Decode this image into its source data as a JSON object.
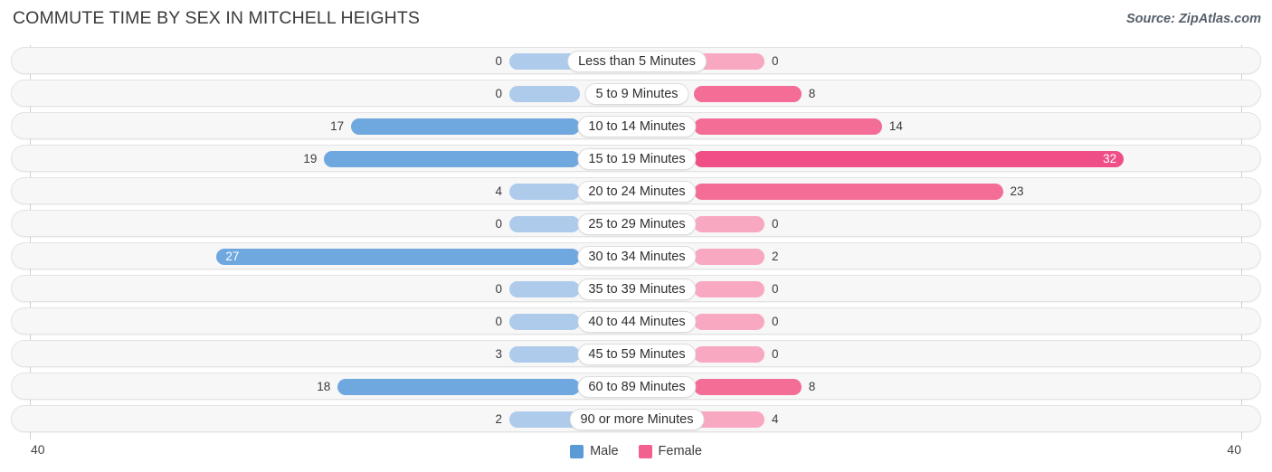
{
  "header": {
    "title": "COMMUTE TIME BY SEX IN MITCHELL HEIGHTS",
    "source": "Source: ZipAtlas.com"
  },
  "axis": {
    "left_tick": "40",
    "right_tick": "40"
  },
  "legend": {
    "items": [
      {
        "label": "Male",
        "color": "#5B9BD5"
      },
      {
        "label": "Female",
        "color": "#F2608F"
      }
    ]
  },
  "colors": {
    "male_strong": "#6EA8DE",
    "male_light": "#AECBEB",
    "female_strong": "#F46D96",
    "female_light": "#F8A8C0",
    "female_bright": "#F04E87",
    "row_bg": "#F7F7F7",
    "row_border": "#E3E3E3"
  },
  "chart_data": {
    "type": "bar",
    "orientation": "horizontal",
    "style": "diverging-tornado",
    "title": "COMMUTE TIME BY SEX IN MITCHELL HEIGHTS",
    "xlabel": "",
    "ylabel": "",
    "xlim": [
      40,
      40
    ],
    "axis_max": 40,
    "grid": false,
    "legend_position": "bottom-center",
    "categories": [
      "Less than 5 Minutes",
      "5 to 9 Minutes",
      "10 to 14 Minutes",
      "15 to 19 Minutes",
      "20 to 24 Minutes",
      "25 to 29 Minutes",
      "30 to 34 Minutes",
      "35 to 39 Minutes",
      "40 to 44 Minutes",
      "45 to 59 Minutes",
      "60 to 89 Minutes",
      "90 or more Minutes"
    ],
    "series": [
      {
        "name": "Male",
        "side": "left",
        "values": [
          0,
          0,
          17,
          19,
          4,
          0,
          27,
          0,
          0,
          3,
          18,
          2
        ]
      },
      {
        "name": "Female",
        "side": "right",
        "values": [
          0,
          8,
          14,
          32,
          23,
          0,
          2,
          0,
          0,
          0,
          8,
          4
        ]
      }
    ]
  },
  "rows": [
    {
      "label": "Less than 5 Minutes",
      "male": 0,
      "female": 0,
      "male_text": "0",
      "female_text": "0"
    },
    {
      "label": "5 to 9 Minutes",
      "male": 0,
      "female": 8,
      "male_text": "0",
      "female_text": "8"
    },
    {
      "label": "10 to 14 Minutes",
      "male": 17,
      "female": 14,
      "male_text": "17",
      "female_text": "14"
    },
    {
      "label": "15 to 19 Minutes",
      "male": 19,
      "female": 32,
      "male_text": "19",
      "female_text": "32"
    },
    {
      "label": "20 to 24 Minutes",
      "male": 4,
      "female": 23,
      "male_text": "4",
      "female_text": "23"
    },
    {
      "label": "25 to 29 Minutes",
      "male": 0,
      "female": 0,
      "male_text": "0",
      "female_text": "0"
    },
    {
      "label": "30 to 34 Minutes",
      "male": 27,
      "female": 2,
      "male_text": "27",
      "female_text": "2"
    },
    {
      "label": "35 to 39 Minutes",
      "male": 0,
      "female": 0,
      "male_text": "0",
      "female_text": "0"
    },
    {
      "label": "40 to 44 Minutes",
      "male": 0,
      "female": 0,
      "male_text": "0",
      "female_text": "0"
    },
    {
      "label": "45 to 59 Minutes",
      "male": 3,
      "female": 0,
      "male_text": "3",
      "female_text": "0"
    },
    {
      "label": "60 to 89 Minutes",
      "male": 18,
      "female": 8,
      "male_text": "18",
      "female_text": "8"
    },
    {
      "label": "90 or more Minutes",
      "male": 2,
      "female": 4,
      "male_text": "2",
      "female_text": "4"
    }
  ]
}
